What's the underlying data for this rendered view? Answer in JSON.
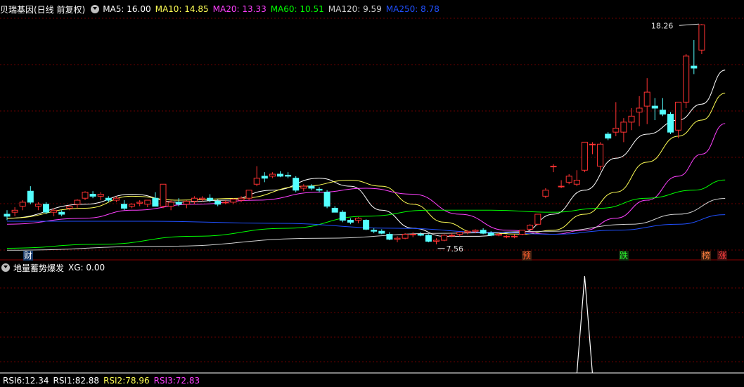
{
  "main_header": {
    "stock": "贝瑞基因(日线 前复权)",
    "ma": [
      {
        "label": "MA5: 16.00",
        "color": "#ffffff"
      },
      {
        "label": "MA10: 14.85",
        "color": "#ffff55"
      },
      {
        "label": "MA20: 13.33",
        "color": "#ff40ff"
      },
      {
        "label": "MA60: 10.51",
        "color": "#00ff00"
      },
      {
        "label": "MA120: 9.59",
        "color": "#d0d0d0"
      },
      {
        "label": "MA250: 8.78",
        "color": "#2050ff"
      }
    ]
  },
  "price_markers": {
    "high": "18.26",
    "low": "7.56"
  },
  "event_tags": [
    {
      "text": "财",
      "color": "#ffffff",
      "bg": "#1a3a6a"
    },
    {
      "text": "预",
      "color": "#ff6030",
      "bg": "#402010"
    },
    {
      "text": "跌",
      "color": "#30ff30",
      "bg": "#103010"
    },
    {
      "text": "榜",
      "color": "#ff8040",
      "bg": "#402010"
    },
    {
      "text": "涨",
      "color": "#ff4040",
      "bg": "#401010"
    }
  ],
  "indicator_header": {
    "name": "地量蓄势爆发",
    "value": "XG: 0.00"
  },
  "bottom_header": [
    {
      "label": "RSI6:12.34",
      "color": "#ffffff"
    },
    {
      "label": "RSI1:82.88",
      "color": "#ffffff"
    },
    {
      "label": "RSI2:78.96",
      "color": "#ffff55"
    },
    {
      "label": "RSI3:72.83",
      "color": "#ff40ff"
    }
  ],
  "chart_data": {
    "type": "candlestick",
    "y_visible_range": [
      6.8,
      18.8
    ],
    "candles": [
      {
        "o": 8.8,
        "h": 9.0,
        "l": 8.5,
        "c": 8.7
      },
      {
        "o": 8.9,
        "h": 9.15,
        "l": 8.7,
        "c": 9.0
      },
      {
        "o": 9.2,
        "h": 9.5,
        "l": 9.0,
        "c": 9.4
      },
      {
        "o": 9.95,
        "h": 10.2,
        "l": 9.3,
        "c": 9.4
      },
      {
        "o": 9.2,
        "h": 9.4,
        "l": 9.0,
        "c": 9.3
      },
      {
        "o": 9.3,
        "h": 9.4,
        "l": 8.8,
        "c": 8.9
      },
      {
        "o": 8.9,
        "h": 9.1,
        "l": 8.7,
        "c": 9.0
      },
      {
        "o": 8.9,
        "h": 9.0,
        "l": 8.7,
        "c": 8.8
      },
      {
        "o": 9.1,
        "h": 9.25,
        "l": 9.0,
        "c": 9.2
      },
      {
        "o": 9.3,
        "h": 9.55,
        "l": 9.1,
        "c": 9.5
      },
      {
        "o": 9.6,
        "h": 9.95,
        "l": 9.5,
        "c": 9.9
      },
      {
        "o": 9.8,
        "h": 9.95,
        "l": 9.6,
        "c": 9.7
      },
      {
        "o": 9.7,
        "h": 9.9,
        "l": 9.5,
        "c": 9.8
      },
      {
        "o": 9.6,
        "h": 9.7,
        "l": 9.4,
        "c": 9.5
      },
      {
        "o": 9.5,
        "h": 9.7,
        "l": 9.4,
        "c": 9.6
      },
      {
        "o": 9.3,
        "h": 9.5,
        "l": 9.0,
        "c": 9.1
      },
      {
        "o": 9.2,
        "h": 9.35,
        "l": 9.1,
        "c": 9.3
      },
      {
        "o": 9.35,
        "h": 9.5,
        "l": 9.2,
        "c": 9.4
      },
      {
        "o": 9.3,
        "h": 9.5,
        "l": 9.15,
        "c": 9.5
      },
      {
        "o": 9.6,
        "h": 9.9,
        "l": 9.4,
        "c": 9.2
      },
      {
        "o": 9.2,
        "h": 10.3,
        "l": 9.1,
        "c": 10.3
      },
      {
        "o": 9.2,
        "h": 9.5,
        "l": 9.0,
        "c": 9.4
      },
      {
        "o": 9.4,
        "h": 9.6,
        "l": 9.2,
        "c": 9.3
      },
      {
        "o": 9.3,
        "h": 9.5,
        "l": 9.1,
        "c": 9.45
      },
      {
        "o": 9.45,
        "h": 9.7,
        "l": 9.3,
        "c": 9.6
      },
      {
        "o": 9.55,
        "h": 9.7,
        "l": 9.45,
        "c": 9.6
      },
      {
        "o": 9.6,
        "h": 9.8,
        "l": 9.4,
        "c": 9.5
      },
      {
        "o": 9.45,
        "h": 9.55,
        "l": 9.2,
        "c": 9.3
      },
      {
        "o": 9.4,
        "h": 9.5,
        "l": 9.3,
        "c": 9.4
      },
      {
        "o": 9.4,
        "h": 9.6,
        "l": 9.3,
        "c": 9.55
      },
      {
        "o": 9.5,
        "h": 9.7,
        "l": 9.4,
        "c": 9.6
      },
      {
        "o": 9.6,
        "h": 10.0,
        "l": 9.5,
        "c": 10.0
      },
      {
        "o": 10.3,
        "h": 11.2,
        "l": 10.2,
        "c": 10.6
      },
      {
        "o": 10.7,
        "h": 10.9,
        "l": 10.4,
        "c": 10.6
      },
      {
        "o": 10.7,
        "h": 10.9,
        "l": 10.6,
        "c": 10.8
      },
      {
        "o": 10.8,
        "h": 10.95,
        "l": 10.65,
        "c": 10.7
      },
      {
        "o": 10.75,
        "h": 10.9,
        "l": 10.6,
        "c": 10.7
      },
      {
        "o": 10.6,
        "h": 10.7,
        "l": 9.9,
        "c": 10.0
      },
      {
        "o": 10.1,
        "h": 10.3,
        "l": 9.95,
        "c": 10.2
      },
      {
        "o": 10.2,
        "h": 10.3,
        "l": 10.0,
        "c": 10.1
      },
      {
        "o": 10.05,
        "h": 10.15,
        "l": 9.9,
        "c": 10.0
      },
      {
        "o": 9.9,
        "h": 10.0,
        "l": 9.1,
        "c": 9.2
      },
      {
        "o": 9.1,
        "h": 9.2,
        "l": 8.9,
        "c": 8.9
      },
      {
        "o": 8.9,
        "h": 9.0,
        "l": 8.4,
        "c": 8.5
      },
      {
        "o": 8.5,
        "h": 8.6,
        "l": 8.3,
        "c": 8.4
      },
      {
        "o": 8.5,
        "h": 8.65,
        "l": 8.35,
        "c": 8.6
      },
      {
        "o": 8.5,
        "h": 8.55,
        "l": 8.0,
        "c": 8.05
      },
      {
        "o": 8.0,
        "h": 8.1,
        "l": 7.85,
        "c": 7.95
      },
      {
        "o": 7.95,
        "h": 8.05,
        "l": 7.8,
        "c": 7.85
      },
      {
        "o": 7.8,
        "h": 7.9,
        "l": 7.5,
        "c": 7.55
      },
      {
        "o": 7.55,
        "h": 7.7,
        "l": 7.4,
        "c": 7.6
      },
      {
        "o": 7.6,
        "h": 7.85,
        "l": 7.55,
        "c": 7.8
      },
      {
        "o": 7.8,
        "h": 7.9,
        "l": 7.65,
        "c": 7.8
      },
      {
        "o": 7.8,
        "h": 7.9,
        "l": 7.7,
        "c": 7.75
      },
      {
        "o": 7.75,
        "h": 7.8,
        "l": 7.4,
        "c": 7.45
      },
      {
        "o": 7.45,
        "h": 7.6,
        "l": 7.3,
        "c": 7.5
      },
      {
        "o": 7.5,
        "h": 7.8,
        "l": 7.45,
        "c": 7.75
      },
      {
        "o": 7.75,
        "h": 7.85,
        "l": 7.65,
        "c": 7.75
      },
      {
        "o": 7.8,
        "h": 7.9,
        "l": 7.7,
        "c": 7.9
      },
      {
        "o": 7.9,
        "h": 8.0,
        "l": 7.8,
        "c": 7.95
      },
      {
        "o": 7.95,
        "h": 8.05,
        "l": 7.85,
        "c": 8.0
      },
      {
        "o": 8.0,
        "h": 8.1,
        "l": 7.8,
        "c": 7.85
      },
      {
        "o": 7.85,
        "h": 7.95,
        "l": 7.7,
        "c": 7.75
      },
      {
        "o": 7.75,
        "h": 7.9,
        "l": 7.7,
        "c": 7.8
      },
      {
        "o": 7.7,
        "h": 7.75,
        "l": 7.6,
        "c": 7.7
      },
      {
        "o": 7.7,
        "h": 7.8,
        "l": 7.6,
        "c": 7.7
      },
      {
        "o": 7.8,
        "h": 8.0,
        "l": 7.75,
        "c": 8.0
      },
      {
        "o": 8.05,
        "h": 8.3,
        "l": 8.0,
        "c": 8.25
      },
      {
        "o": 8.3,
        "h": 8.8,
        "l": 8.25,
        "c": 8.8
      },
      {
        "o": 9.7,
        "h": 10.1,
        "l": 9.6,
        "c": 10.0
      },
      {
        "o": 11.2,
        "h": 11.3,
        "l": 10.9,
        "c": 11.2
      },
      {
        "o": 10.2,
        "h": 10.5,
        "l": 10.1,
        "c": 10.2
      },
      {
        "o": 10.4,
        "h": 10.8,
        "l": 10.3,
        "c": 10.7
      },
      {
        "o": 10.3,
        "h": 11.0,
        "l": 10.2,
        "c": 10.5
      },
      {
        "o": 11.0,
        "h": 12.4,
        "l": 10.9,
        "c": 12.4
      },
      {
        "o": 12.3,
        "h": 12.4,
        "l": 11.8,
        "c": 12.3
      },
      {
        "o": 11.2,
        "h": 12.4,
        "l": 11.0,
        "c": 12.3
      },
      {
        "o": 12.8,
        "h": 12.9,
        "l": 12.5,
        "c": 12.6
      },
      {
        "o": 12.9,
        "h": 14.4,
        "l": 12.7,
        "c": 13.1
      },
      {
        "o": 12.9,
        "h": 13.6,
        "l": 12.4,
        "c": 13.4
      },
      {
        "o": 13.4,
        "h": 14.1,
        "l": 13.0,
        "c": 13.7
      },
      {
        "o": 13.9,
        "h": 14.7,
        "l": 13.2,
        "c": 14.1
      },
      {
        "o": 14.2,
        "h": 15.6,
        "l": 13.3,
        "c": 14.9
      },
      {
        "o": 14.2,
        "h": 14.6,
        "l": 13.5,
        "c": 14.1
      },
      {
        "o": 14.0,
        "h": 14.6,
        "l": 13.7,
        "c": 13.8
      },
      {
        "o": 13.8,
        "h": 13.9,
        "l": 12.8,
        "c": 12.9
      },
      {
        "o": 13.0,
        "h": 14.4,
        "l": 12.6,
        "c": 14.4
      },
      {
        "o": 14.4,
        "h": 16.8,
        "l": 14.1,
        "c": 16.7
      },
      {
        "o": 16.2,
        "h": 17.5,
        "l": 15.8,
        "c": 16.1
      },
      {
        "o": 17.0,
        "h": 18.3,
        "l": 16.8,
        "c": 18.26
      }
    ],
    "moving_averages": {
      "MA5": [
        [
          0,
          8.6
        ],
        [
          10,
          9.3
        ],
        [
          16,
          9.8
        ],
        [
          22,
          9.4
        ],
        [
          28,
          9.5
        ],
        [
          34,
          10.0
        ],
        [
          40,
          10.6
        ],
        [
          44,
          10.2
        ],
        [
          48,
          9.0
        ],
        [
          52,
          8.1
        ],
        [
          56,
          7.7
        ],
        [
          60,
          7.7
        ],
        [
          66,
          7.9
        ],
        [
          70,
          8.8
        ],
        [
          74,
          10.0
        ],
        [
          78,
          11.6
        ],
        [
          82,
          12.8
        ],
        [
          86,
          13.5
        ],
        [
          89,
          14.3
        ],
        [
          92,
          16.0
        ]
      ],
      "MA10": [
        [
          0,
          8.6
        ],
        [
          10,
          9.1
        ],
        [
          16,
          9.7
        ],
        [
          22,
          9.5
        ],
        [
          30,
          9.6
        ],
        [
          38,
          10.2
        ],
        [
          44,
          10.5
        ],
        [
          48,
          10.2
        ],
        [
          52,
          9.3
        ],
        [
          56,
          8.4
        ],
        [
          60,
          7.9
        ],
        [
          66,
          7.8
        ],
        [
          70,
          8.0
        ],
        [
          74,
          8.8
        ],
        [
          78,
          9.9
        ],
        [
          82,
          11.4
        ],
        [
          86,
          12.7
        ],
        [
          89,
          13.5
        ],
        [
          92,
          14.85
        ]
      ],
      "MA20": [
        [
          0,
          8.3
        ],
        [
          10,
          8.6
        ],
        [
          16,
          9.0
        ],
        [
          24,
          9.3
        ],
        [
          32,
          9.5
        ],
        [
          40,
          9.9
        ],
        [
          46,
          10.1
        ],
        [
          52,
          9.8
        ],
        [
          58,
          8.8
        ],
        [
          64,
          8.0
        ],
        [
          70,
          7.8
        ],
        [
          74,
          8.0
        ],
        [
          78,
          8.6
        ],
        [
          82,
          9.5
        ],
        [
          86,
          10.7
        ],
        [
          89,
          11.8
        ],
        [
          92,
          13.33
        ]
      ],
      "MA60": [
        [
          0,
          7.1
        ],
        [
          12,
          7.3
        ],
        [
          24,
          7.7
        ],
        [
          36,
          8.1
        ],
        [
          46,
          8.7
        ],
        [
          54,
          9.0
        ],
        [
          62,
          9.0
        ],
        [
          70,
          8.9
        ],
        [
          76,
          9.1
        ],
        [
          82,
          9.6
        ],
        [
          88,
          10.0
        ],
        [
          92,
          10.51
        ]
      ],
      "MA120": [
        [
          0,
          7.0
        ],
        [
          20,
          7.2
        ],
        [
          40,
          7.6
        ],
        [
          56,
          7.85
        ],
        [
          70,
          7.95
        ],
        [
          80,
          8.3
        ],
        [
          86,
          8.8
        ],
        [
          92,
          9.59
        ]
      ],
      "MA250": [
        [
          0,
          8.45
        ],
        [
          18,
          8.45
        ],
        [
          34,
          8.35
        ],
        [
          50,
          8.1
        ],
        [
          62,
          7.9
        ],
        [
          70,
          7.8
        ],
        [
          78,
          8.0
        ],
        [
          86,
          8.3
        ],
        [
          92,
          8.78
        ]
      ]
    },
    "xg_signal_index": 74,
    "xg_values": [
      0,
      1
    ]
  }
}
